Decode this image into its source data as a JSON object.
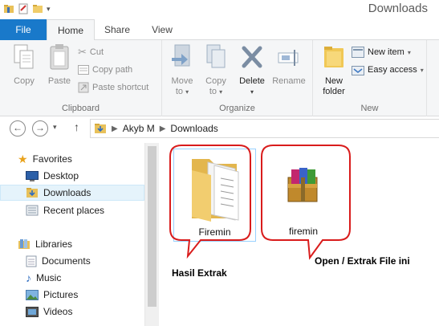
{
  "window": {
    "title": "Downloads"
  },
  "tabs": [
    "File",
    "Home",
    "Share",
    "View"
  ],
  "ribbon": {
    "clipboard": {
      "label": "Clipboard",
      "copy": "Copy",
      "paste": "Paste",
      "cut": "Cut",
      "copy_path": "Copy path",
      "paste_shortcut": "Paste shortcut"
    },
    "organize": {
      "label": "Organize",
      "move_to": [
        "Move",
        "to"
      ],
      "copy_to": [
        "Copy",
        "to"
      ],
      "delete": "Delete",
      "rename": "Rename"
    },
    "new": {
      "label": "New",
      "new_folder": [
        "New",
        "folder"
      ],
      "new_item": "New item",
      "easy_access": "Easy access"
    }
  },
  "address": {
    "crumbs": [
      "Akyb M",
      "Downloads"
    ]
  },
  "nav": {
    "favorites": "Favorites",
    "desktop": "Desktop",
    "downloads": "Downloads",
    "recent": "Recent places",
    "libraries": "Libraries",
    "documents": "Documents",
    "music": "Music",
    "pictures": "Pictures",
    "videos": "Videos"
  },
  "files": [
    {
      "name": "Firemin",
      "type": "folder"
    },
    {
      "name": "firemin",
      "type": "archive"
    }
  ],
  "annotations": {
    "left": "Hasil Extrak",
    "right": "Open / Extrak File ini",
    "color": "#d91c1c"
  }
}
